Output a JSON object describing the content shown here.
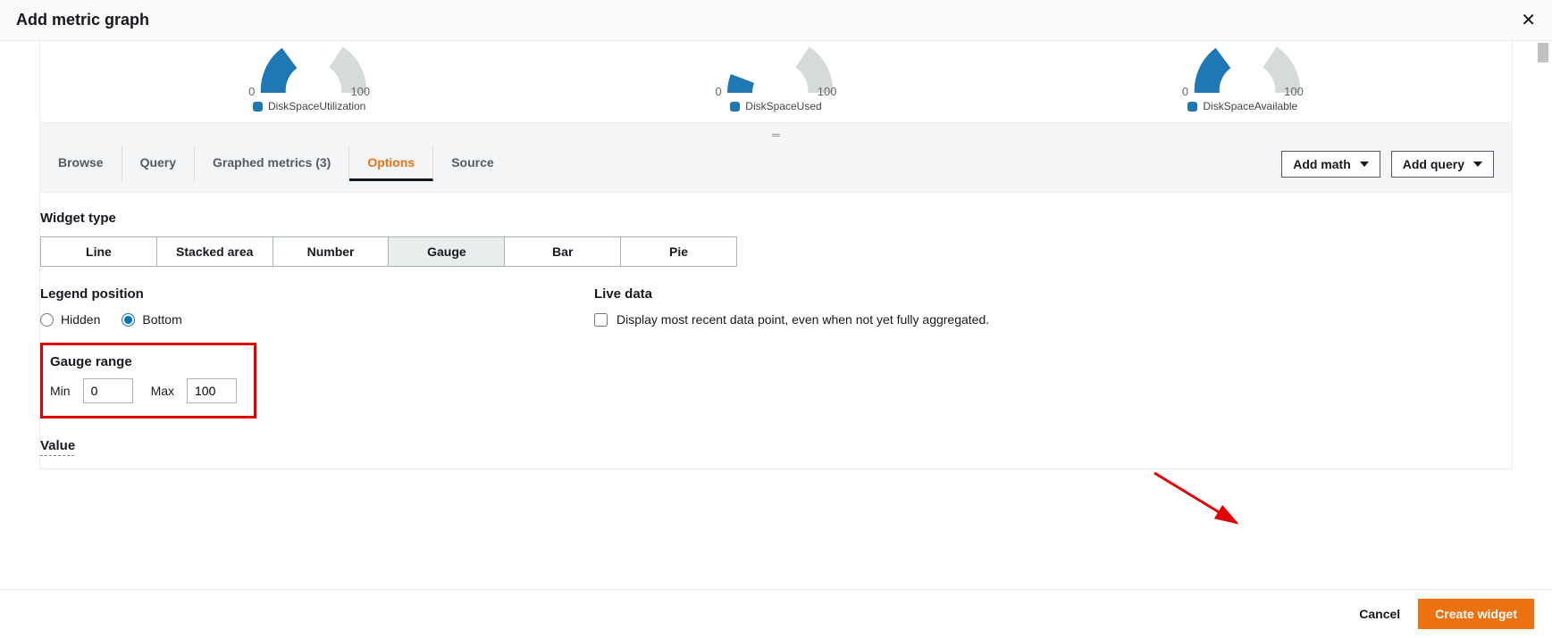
{
  "header": {
    "title": "Add metric graph"
  },
  "gauges": [
    {
      "min": "0",
      "max": "100",
      "legend": "DiskSpaceUtilization"
    },
    {
      "min": "0",
      "max": "100",
      "legend": "DiskSpaceUsed"
    },
    {
      "min": "0",
      "max": "100",
      "legend": "DiskSpaceAvailable"
    }
  ],
  "tabs": {
    "browse": "Browse",
    "query": "Query",
    "graphed": "Graphed metrics (3)",
    "options": "Options",
    "source": "Source"
  },
  "buttons": {
    "add_math": "Add math",
    "add_query": "Add query"
  },
  "options": {
    "widget_type_label": "Widget type",
    "types": {
      "line": "Line",
      "stacked": "Stacked area",
      "number": "Number",
      "gauge": "Gauge",
      "bar": "Bar",
      "pie": "Pie"
    },
    "legend_position_label": "Legend position",
    "legend": {
      "hidden": "Hidden",
      "bottom": "Bottom"
    },
    "live_data_label": "Live data",
    "live_data_desc": "Display most recent data point, even when not yet fully aggregated.",
    "gauge_range_label": "Gauge range",
    "gauge_min_label": "Min",
    "gauge_min_value": "0",
    "gauge_max_label": "Max",
    "gauge_max_value": "100",
    "value_label": "Value"
  },
  "footer": {
    "cancel": "Cancel",
    "create": "Create widget"
  },
  "chart_data": [
    {
      "type": "gauge",
      "name": "DiskSpaceUtilization",
      "min": 0,
      "max": 100,
      "value": 9
    },
    {
      "type": "gauge",
      "name": "DiskSpaceUsed",
      "min": 0,
      "max": 100,
      "value": 3
    },
    {
      "type": "gauge",
      "name": "DiskSpaceAvailable",
      "min": 0,
      "max": 100,
      "value": 9
    }
  ]
}
